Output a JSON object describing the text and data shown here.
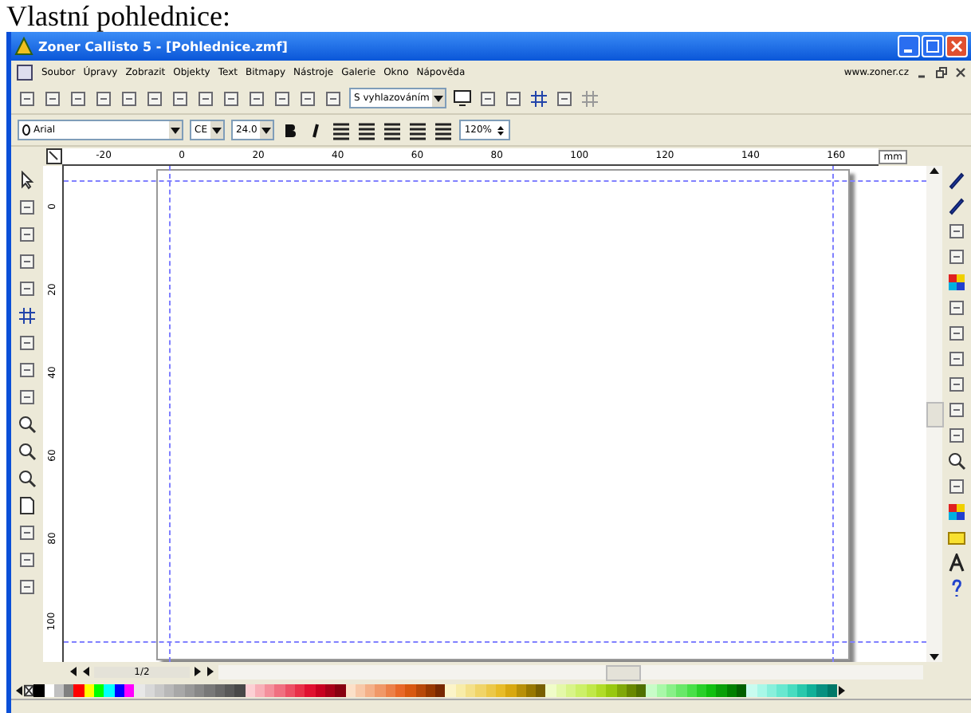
{
  "caption": "Vlastní pohlednice:",
  "window": {
    "title": "Zoner Callisto 5 - [Pohlednice.zmf]"
  },
  "menu": {
    "items": [
      "Soubor",
      "Úpravy",
      "Zobrazit",
      "Objekty",
      "Text",
      "Bitmapy",
      "Nástroje",
      "Galerie",
      "Okno",
      "Nápověda"
    ],
    "link": "www.zoner.cz"
  },
  "toolbar": {
    "render_mode": "S vyhlazováním"
  },
  "format_bar": {
    "font": "Arial",
    "charset": "CE",
    "size": "24.0",
    "zoom": "120%"
  },
  "ruler": {
    "horizontal": [
      "-20",
      "0",
      "20",
      "40",
      "60",
      "80",
      "100",
      "120",
      "140",
      "160"
    ],
    "unit": "mm",
    "vertical": [
      "0",
      "20",
      "40",
      "60",
      "80",
      "100"
    ]
  },
  "page_nav": {
    "page": "1/2"
  },
  "palette": [
    {
      "color": "#000000"
    },
    {
      "color": "#ffffff"
    },
    {
      "color": "#c0c0c0"
    },
    {
      "color": "#808080"
    },
    {
      "color": "#ff0000"
    },
    {
      "color": "#ffff00"
    },
    {
      "color": "#00ff00"
    },
    {
      "color": "#00ffff"
    },
    {
      "color": "#0000ff"
    },
    {
      "color": "#ff00ff"
    },
    {
      "color": "#e8e8e8"
    },
    {
      "color": "#d8d8d8"
    },
    {
      "color": "#c8c8c8"
    },
    {
      "color": "#b8b8b8"
    },
    {
      "color": "#a8a8a8"
    },
    {
      "color": "#989898"
    },
    {
      "color": "#888888"
    },
    {
      "color": "#787878"
    },
    {
      "color": "#686868"
    },
    {
      "color": "#585858"
    },
    {
      "color": "#484848"
    },
    {
      "color": "#fcd0d4"
    },
    {
      "color": "#f8b0b8"
    },
    {
      "color": "#f4909c"
    },
    {
      "color": "#f07080"
    },
    {
      "color": "#ec5064"
    },
    {
      "color": "#e83048"
    },
    {
      "color": "#e01030"
    },
    {
      "color": "#c80020"
    },
    {
      "color": "#a80018"
    },
    {
      "color": "#880010"
    },
    {
      "color": "#fce0c8"
    },
    {
      "color": "#f8c8a8"
    },
    {
      "color": "#f4b088"
    },
    {
      "color": "#f09868"
    },
    {
      "color": "#ec8048"
    },
    {
      "color": "#e86828"
    },
    {
      "color": "#d85810"
    },
    {
      "color": "#b84808"
    },
    {
      "color": "#983800"
    },
    {
      "color": "#782800"
    },
    {
      "color": "#fcf4c8"
    },
    {
      "color": "#f8eca8"
    },
    {
      "color": "#f4e088"
    },
    {
      "color": "#f0d468"
    },
    {
      "color": "#ecc848"
    },
    {
      "color": "#e8bc28"
    },
    {
      "color": "#d8a810"
    },
    {
      "color": "#b89008"
    },
    {
      "color": "#987800"
    },
    {
      "color": "#786000"
    },
    {
      "color": "#f0fcc8"
    },
    {
      "color": "#e4f8a8"
    },
    {
      "color": "#d8f488"
    },
    {
      "color": "#ccf068"
    },
    {
      "color": "#c0e848"
    },
    {
      "color": "#b0dc28"
    },
    {
      "color": "#98c810"
    },
    {
      "color": "#80a808"
    },
    {
      "color": "#688800"
    },
    {
      "color": "#507000"
    },
    {
      "color": "#c8fcc8"
    },
    {
      "color": "#a8f8a8"
    },
    {
      "color": "#88f088"
    },
    {
      "color": "#68e868"
    },
    {
      "color": "#48e048"
    },
    {
      "color": "#28d028"
    },
    {
      "color": "#10c010"
    },
    {
      "color": "#08a008"
    },
    {
      "color": "#008000"
    },
    {
      "color": "#006000"
    },
    {
      "color": "#c8fcf0"
    },
    {
      "color": "#a8f8e8"
    },
    {
      "color": "#88f0dc"
    },
    {
      "color": "#68e8d0"
    },
    {
      "color": "#48dcc0"
    },
    {
      "color": "#28c8ac"
    },
    {
      "color": "#10b098"
    },
    {
      "color": "#089080"
    },
    {
      "color": "#007868"
    }
  ]
}
